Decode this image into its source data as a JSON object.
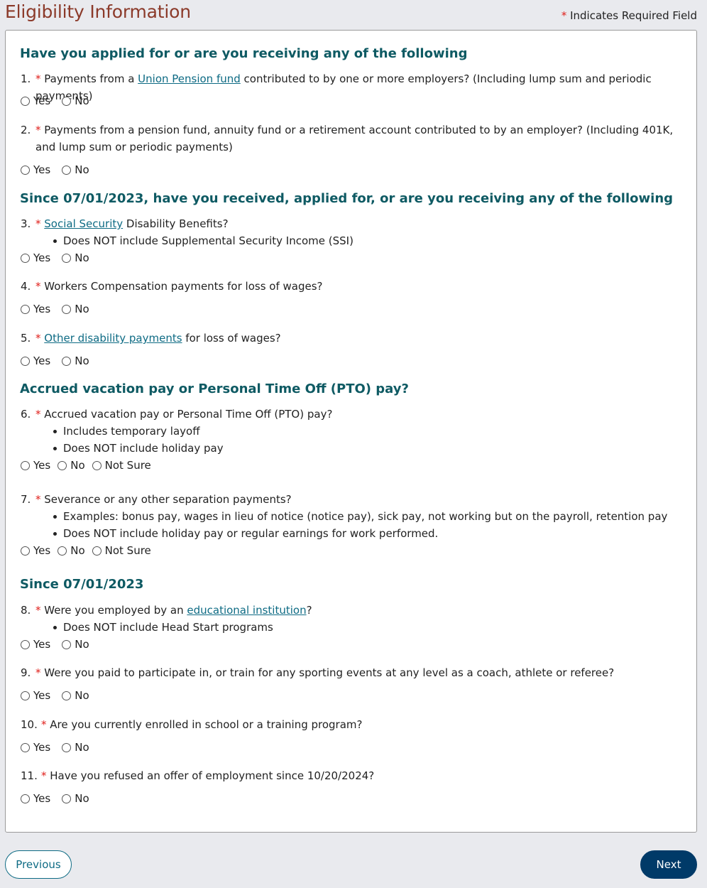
{
  "header": {
    "title": "Eligibility Information",
    "required_star": "*",
    "required_note": "Indicates Required Field"
  },
  "sections": [
    {
      "heading": "Have you applied for or are you receiving any of the following"
    },
    {
      "heading": "Since 07/01/2023, have you received, applied for, or are you receiving any of the following"
    },
    {
      "heading": "Accrued vacation pay or Personal Time Off (PTO) pay?"
    },
    {
      "heading": "Since 07/01/2023"
    }
  ],
  "questions": [
    {
      "num": "1.",
      "pre": "Payments from a ",
      "link": "Union Pension fund",
      "post": " contributed to by one or more employers? (Including lump sum and periodic payments)",
      "notes": [],
      "options": [
        "Yes",
        "No"
      ]
    },
    {
      "num": "2.",
      "pre": "Payments from a pension fund, annuity fund or a retirement account contributed to by an employer? (Including 401K, and lump sum or periodic payments)",
      "link": "",
      "post": "",
      "notes": [],
      "options": [
        "Yes",
        "No"
      ]
    },
    {
      "num": "3.",
      "pre": "",
      "link": "Social Security",
      "post": " Disability Benefits?",
      "notes": [
        "Does NOT include Supplemental Security Income (SSI)"
      ],
      "options": [
        "Yes",
        "No"
      ]
    },
    {
      "num": "4.",
      "pre": "Workers Compensation payments for loss of wages?",
      "link": "",
      "post": "",
      "notes": [],
      "options": [
        "Yes",
        "No"
      ]
    },
    {
      "num": "5.",
      "pre": "",
      "link": "Other disability payments",
      "post": " for loss of wages?",
      "notes": [],
      "options": [
        "Yes",
        "No"
      ]
    },
    {
      "num": "6.",
      "pre": "Accrued vacation pay or Personal Time Off (PTO) pay?",
      "link": "",
      "post": "",
      "notes": [
        "Includes temporary layoff",
        "Does NOT include holiday pay"
      ],
      "options": [
        "Yes",
        "No",
        "Not Sure"
      ]
    },
    {
      "num": "7.",
      "pre": "Severance or any other separation payments?",
      "link": "",
      "post": "",
      "notes": [
        "Examples: bonus pay, wages in lieu of notice (notice pay), sick pay, not working but on the payroll, retention pay",
        "Does NOT include holiday pay or regular earnings for work performed."
      ],
      "options": [
        "Yes",
        "No",
        "Not Sure"
      ]
    },
    {
      "num": "8.",
      "pre": "Were you employed by an ",
      "link": "educational institution",
      "post": "?",
      "notes": [
        "Does NOT include Head Start programs"
      ],
      "options": [
        "Yes",
        "No"
      ]
    },
    {
      "num": "9.",
      "pre": "Were you paid to participate in, or train for any sporting events at any level as a coach, athlete or referee?",
      "link": "",
      "post": "",
      "notes": [],
      "options": [
        "Yes",
        "No"
      ]
    },
    {
      "num": "10.",
      "pre": "Are you currently enrolled in school or a training program?",
      "link": "",
      "post": "",
      "notes": [],
      "options": [
        "Yes",
        "No"
      ]
    },
    {
      "num": "11.",
      "pre": "Have you refused an offer of employment since 10/20/2024?",
      "link": "",
      "post": "",
      "notes": [],
      "options": [
        "Yes",
        "No"
      ]
    }
  ],
  "buttons": {
    "previous": "Previous",
    "next": "Next"
  },
  "colors": {
    "title": "#8b3a2a",
    "heading": "#0e5a63",
    "link": "#0e6b84",
    "required": "#e0201c",
    "next_button": "#003a68",
    "background": "#e9eaee"
  }
}
